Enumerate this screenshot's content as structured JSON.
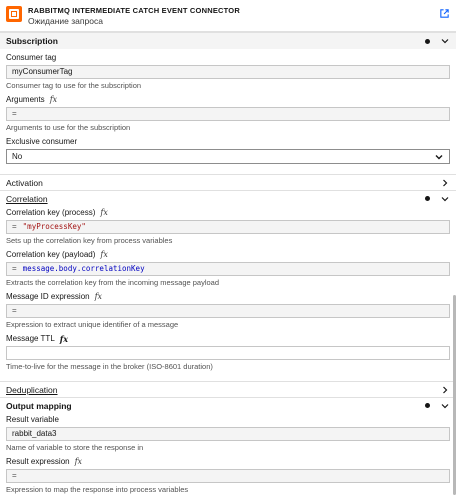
{
  "header": {
    "title": "RABBITMQ INTERMEDIATE CATCH EVENT CONNECTOR",
    "subtitle": "Ожидание запроса"
  },
  "subscription": {
    "title": "Subscription",
    "consumer_tag": {
      "label": "Consumer tag",
      "value": "myConsumerTag",
      "hint": "Consumer tag to use for the subscription"
    },
    "arguments": {
      "label": "Arguments",
      "value": "=",
      "hint": "Arguments to use for the subscription"
    },
    "exclusive": {
      "label": "Exclusive consumer",
      "value": "No"
    }
  },
  "activation": {
    "title": "Activation"
  },
  "correlation": {
    "title": "Correlation",
    "key_process": {
      "label": "Correlation key (process)",
      "prefix": "=",
      "value": "\"myProcessKey\"",
      "hint": "Sets up the correlation key from process variables"
    },
    "key_payload": {
      "label": "Correlation key (payload)",
      "prefix": "=",
      "value": "message.body.correlationKey",
      "hint": "Extracts the correlation key from the incoming message payload"
    },
    "message_id": {
      "label": "Message ID expression",
      "value": "=",
      "hint": "Expression to extract unique identifier of a message"
    },
    "message_ttl": {
      "label": "Message TTL",
      "value": "",
      "hint": "Time-to-live for the message in the broker (ISO-8601 duration)"
    }
  },
  "deduplication": {
    "title": "Deduplication"
  },
  "output": {
    "title": "Output mapping",
    "result_variable": {
      "label": "Result variable",
      "value": "rabbit_data3",
      "hint": "Name of variable to store the response in"
    },
    "result_expression": {
      "label": "Result expression",
      "value": "=",
      "hint": "Expression to map the response into process variables"
    }
  },
  "fx_symbol": "fx",
  "colors": {
    "logo": "#ff6600",
    "link": "#0f62fe"
  }
}
